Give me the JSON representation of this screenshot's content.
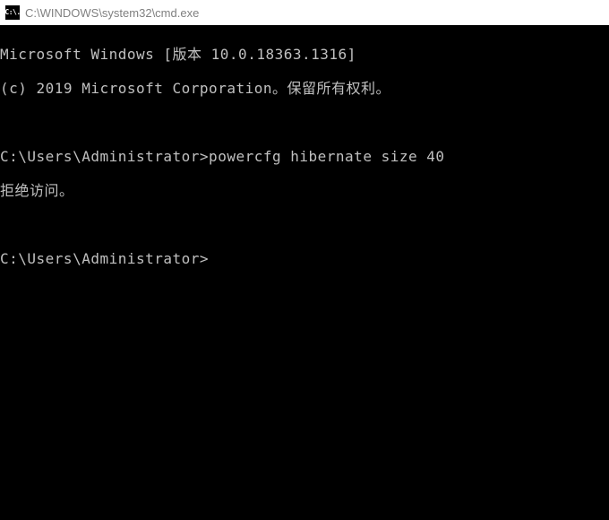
{
  "titlebar": {
    "icon_text": "C:\\.",
    "title": "C:\\WINDOWS\\system32\\cmd.exe"
  },
  "terminal": {
    "lines": [
      "Microsoft Windows [版本 10.0.18363.1316]",
      "(c) 2019 Microsoft Corporation。保留所有权利。",
      "",
      "C:\\Users\\Administrator>powercfg hibernate size 40",
      "拒绝访问。",
      "",
      "C:\\Users\\Administrator>"
    ]
  }
}
